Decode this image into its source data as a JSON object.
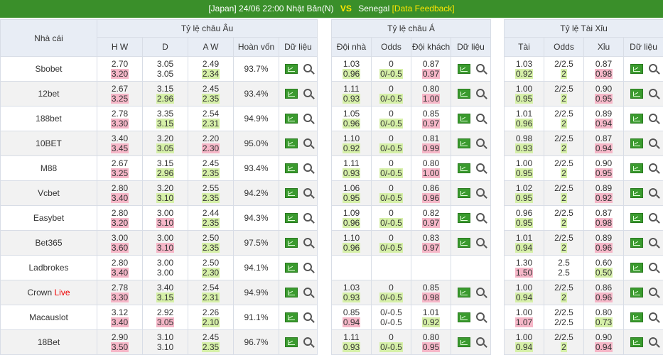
{
  "match": {
    "league": "[Japan]",
    "datetime": "24/06 22:00",
    "home": "Nhật Bản(N)",
    "vs": "VS",
    "away": "Senegal",
    "feedback": "[Data Feedback]"
  },
  "headers": {
    "bookmaker": "Nhà cái",
    "euro": "Tỷ lệ châu Âu",
    "asia": "Tỷ lệ châu Á",
    "ou": "Tỷ lệ Tài Xỉu",
    "euro_cols": [
      "H W",
      "D",
      "A W",
      "Hoàn vốn",
      "Dữ liệu"
    ],
    "asia_cols": [
      "Đội nhà",
      "Odds",
      "Đội khách",
      "Dữ liệu"
    ],
    "ou_cols": [
      "Tài",
      "Odds",
      "Xỉu",
      "Dữ liệu"
    ]
  },
  "rows": [
    {
      "book": "Sbobet",
      "live": "",
      "euro": [
        [
          "2.70",
          "3.20"
        ],
        [
          "3.05",
          "3.05"
        ],
        [
          "2.49",
          "2.34"
        ]
      ],
      "euro_hl": [
        "",
        "pk",
        "",
        "",
        "",
        "gr"
      ],
      "refund": "93.7%",
      "asia": [
        [
          "1.03",
          "0.96"
        ],
        [
          "0",
          "0/-0.5"
        ],
        [
          "0.87",
          "0.97"
        ]
      ],
      "asia_hl": [
        "",
        "gr",
        "",
        "gr",
        "",
        "pk"
      ],
      "ou": [
        [
          "1.03",
          "0.92"
        ],
        [
          "2/2.5",
          "2"
        ],
        [
          "0.87",
          "0.98"
        ]
      ],
      "ou_hl": [
        "",
        "gr",
        "",
        "gr",
        "",
        "pk"
      ]
    },
    {
      "book": "12bet",
      "live": "",
      "euro": [
        [
          "2.67",
          "3.25"
        ],
        [
          "3.15",
          "2.96"
        ],
        [
          "2.45",
          "2.35"
        ]
      ],
      "euro_hl": [
        "",
        "pk",
        "",
        "gr",
        "",
        "gr"
      ],
      "refund": "93.4%",
      "asia": [
        [
          "1.11",
          "0.93"
        ],
        [
          "0",
          "0/-0.5"
        ],
        [
          "0.80",
          "1.00"
        ]
      ],
      "asia_hl": [
        "",
        "gr",
        "",
        "gr",
        "",
        "pk"
      ],
      "ou": [
        [
          "1.00",
          "0.95"
        ],
        [
          "2/2.5",
          "2"
        ],
        [
          "0.90",
          "0.95"
        ]
      ],
      "ou_hl": [
        "",
        "gr",
        "",
        "gr",
        "",
        "pk"
      ]
    },
    {
      "book": "188bet",
      "live": "",
      "euro": [
        [
          "2.78",
          "3.30"
        ],
        [
          "3.35",
          "3.15"
        ],
        [
          "2.54",
          "2.31"
        ]
      ],
      "euro_hl": [
        "",
        "pk",
        "",
        "gr",
        "",
        "gr"
      ],
      "refund": "94.9%",
      "asia": [
        [
          "1.05",
          "0.96"
        ],
        [
          "0",
          "0/-0.5"
        ],
        [
          "0.85",
          "0.97"
        ]
      ],
      "asia_hl": [
        "",
        "gr",
        "",
        "gr",
        "",
        "pk"
      ],
      "ou": [
        [
          "1.01",
          "0.96"
        ],
        [
          "2/2.5",
          "2"
        ],
        [
          "0.89",
          "0.94"
        ]
      ],
      "ou_hl": [
        "",
        "gr",
        "",
        "gr",
        "",
        "pk"
      ]
    },
    {
      "book": "10BET",
      "live": "",
      "euro": [
        [
          "3.40",
          "3.45"
        ],
        [
          "3.20",
          "3.05"
        ],
        [
          "2.20",
          "2.30"
        ]
      ],
      "euro_hl": [
        "",
        "pk",
        "",
        "gr",
        "",
        "pk"
      ],
      "refund": "95.0%",
      "asia": [
        [
          "1.10",
          "0.92"
        ],
        [
          "0",
          "0/-0.5"
        ],
        [
          "0.81",
          "0.99"
        ]
      ],
      "asia_hl": [
        "",
        "gr",
        "",
        "gr",
        "",
        "pk"
      ],
      "ou": [
        [
          "0.98",
          "0.93"
        ],
        [
          "2/2.5",
          "2"
        ],
        [
          "0.87",
          "0.94"
        ]
      ],
      "ou_hl": [
        "",
        "gr",
        "",
        "gr",
        "",
        "pk"
      ]
    },
    {
      "book": "M88",
      "live": "",
      "euro": [
        [
          "2.67",
          "3.25"
        ],
        [
          "3.15",
          "2.96"
        ],
        [
          "2.45",
          "2.35"
        ]
      ],
      "euro_hl": [
        "",
        "pk",
        "",
        "gr",
        "",
        "gr"
      ],
      "refund": "93.4%",
      "asia": [
        [
          "1.11",
          "0.93"
        ],
        [
          "0",
          "0/-0.5"
        ],
        [
          "0.80",
          "1.00"
        ]
      ],
      "asia_hl": [
        "",
        "gr",
        "",
        "gr",
        "",
        "pk"
      ],
      "ou": [
        [
          "1.00",
          "0.95"
        ],
        [
          "2/2.5",
          "2"
        ],
        [
          "0.90",
          "0.95"
        ]
      ],
      "ou_hl": [
        "",
        "gr",
        "",
        "gr",
        "",
        "pk"
      ]
    },
    {
      "book": "Vcbet",
      "live": "",
      "euro": [
        [
          "2.80",
          "3.40"
        ],
        [
          "3.20",
          "3.10"
        ],
        [
          "2.55",
          "2.35"
        ]
      ],
      "euro_hl": [
        "",
        "pk",
        "",
        "gr",
        "",
        "gr"
      ],
      "refund": "94.2%",
      "asia": [
        [
          "1.06",
          "0.95"
        ],
        [
          "0",
          "0/-0.5"
        ],
        [
          "0.86",
          "0.96"
        ]
      ],
      "asia_hl": [
        "",
        "gr",
        "",
        "gr",
        "",
        "pk"
      ],
      "ou": [
        [
          "1.02",
          "0.95"
        ],
        [
          "2/2.5",
          "2"
        ],
        [
          "0.89",
          "0.92"
        ]
      ],
      "ou_hl": [
        "",
        "gr",
        "",
        "gr",
        "",
        "pk"
      ]
    },
    {
      "book": "Easybet",
      "live": "",
      "euro": [
        [
          "2.80",
          "3.20"
        ],
        [
          "3.00",
          "3.10"
        ],
        [
          "2.44",
          "2.35"
        ]
      ],
      "euro_hl": [
        "",
        "pk",
        "",
        "pk",
        "",
        "gr"
      ],
      "refund": "94.3%",
      "asia": [
        [
          "1.09",
          "0.96"
        ],
        [
          "0",
          "0/-0.5"
        ],
        [
          "0.82",
          "0.97"
        ]
      ],
      "asia_hl": [
        "",
        "gr",
        "",
        "gr",
        "",
        "pk"
      ],
      "ou": [
        [
          "0.96",
          "0.95"
        ],
        [
          "2/2.5",
          "2"
        ],
        [
          "0.87",
          "0.98"
        ]
      ],
      "ou_hl": [
        "",
        "gr",
        "",
        "gr",
        "",
        "pk"
      ]
    },
    {
      "book": "Bet365",
      "live": "",
      "euro": [
        [
          "3.00",
          "3.60"
        ],
        [
          "3.00",
          "3.10"
        ],
        [
          "2.50",
          "2.35"
        ]
      ],
      "euro_hl": [
        "",
        "pk",
        "",
        "pk",
        "",
        "gr"
      ],
      "refund": "97.5%",
      "asia": [
        [
          "1.10",
          "0.96"
        ],
        [
          "0",
          "0/-0.5"
        ],
        [
          "0.83",
          "0.97"
        ]
      ],
      "asia_hl": [
        "",
        "gr",
        "",
        "gr",
        "",
        "pk"
      ],
      "ou": [
        [
          "1.01",
          "0.94"
        ],
        [
          "2/2.5",
          "2"
        ],
        [
          "0.89",
          "0.96"
        ]
      ],
      "ou_hl": [
        "",
        "gr",
        "",
        "gr",
        "",
        "pk"
      ]
    },
    {
      "book": "Ladbrokes",
      "live": "",
      "euro": [
        [
          "2.80",
          "3.40"
        ],
        [
          "3.00",
          "3.00"
        ],
        [
          "2.50",
          "2.30"
        ]
      ],
      "euro_hl": [
        "",
        "pk",
        "",
        "",
        "",
        "gr"
      ],
      "refund": "94.1%",
      "asia": [
        [
          "",
          ""
        ],
        [
          "",
          ""
        ],
        [
          "",
          ""
        ]
      ],
      "asia_hl": [
        "",
        "",
        "",
        "",
        "",
        ""
      ],
      "ou": [
        [
          "1.30",
          "1.50"
        ],
        [
          "2.5",
          "2.5"
        ],
        [
          "0.60",
          "0.50"
        ]
      ],
      "ou_hl": [
        "",
        "pk",
        "",
        "",
        "",
        "gr"
      ]
    },
    {
      "book": "Crown",
      "live": "Live",
      "euro": [
        [
          "2.78",
          "3.30"
        ],
        [
          "3.40",
          "3.15"
        ],
        [
          "2.54",
          "2.31"
        ]
      ],
      "euro_hl": [
        "",
        "pk",
        "",
        "gr",
        "",
        "gr"
      ],
      "refund": "94.9%",
      "asia": [
        [
          "1.03",
          "0.93"
        ],
        [
          "0",
          "0/-0.5"
        ],
        [
          "0.85",
          "0.98"
        ]
      ],
      "asia_hl": [
        "",
        "gr",
        "",
        "gr",
        "",
        "pk"
      ],
      "ou": [
        [
          "1.00",
          "0.94"
        ],
        [
          "2/2.5",
          "2"
        ],
        [
          "0.86",
          "0.96"
        ]
      ],
      "ou_hl": [
        "",
        "gr",
        "",
        "gr",
        "",
        "pk"
      ]
    },
    {
      "book": "Macauslot",
      "live": "",
      "euro": [
        [
          "3.12",
          "3.40"
        ],
        [
          "2.92",
          "3.05"
        ],
        [
          "2.26",
          "2.10"
        ]
      ],
      "euro_hl": [
        "",
        "pk",
        "",
        "pk",
        "",
        "gr"
      ],
      "refund": "91.1%",
      "asia": [
        [
          "0.85",
          "0.94"
        ],
        [
          "0/-0.5",
          "0/-0.5"
        ],
        [
          "1.01",
          "0.92"
        ]
      ],
      "asia_hl": [
        "",
        "pk",
        "",
        "",
        "",
        "gr"
      ],
      "ou": [
        [
          "1.00",
          "1.07"
        ],
        [
          "2/2.5",
          "2/2.5"
        ],
        [
          "0.80",
          "0.73"
        ]
      ],
      "ou_hl": [
        "",
        "pk",
        "",
        "",
        "",
        "gr"
      ]
    },
    {
      "book": "18Bet",
      "live": "",
      "euro": [
        [
          "2.90",
          "3.50"
        ],
        [
          "3.10",
          "3.10"
        ],
        [
          "2.45",
          "2.35"
        ]
      ],
      "euro_hl": [
        "",
        "pk",
        "",
        "",
        "",
        "gr"
      ],
      "refund": "96.7%",
      "asia": [
        [
          "1.11",
          "0.93"
        ],
        [
          "0",
          "0/-0.5"
        ],
        [
          "0.80",
          "0.95"
        ]
      ],
      "asia_hl": [
        "",
        "gr",
        "",
        "gr",
        "",
        "pk"
      ],
      "ou": [
        [
          "1.00",
          "0.94"
        ],
        [
          "2/2.5",
          "2"
        ],
        [
          "0.90",
          "0.94"
        ]
      ],
      "ou_hl": [
        "",
        "gr",
        "",
        "gr",
        "",
        "pk"
      ]
    }
  ],
  "colors": {
    "header_bar": "#3a8f2a",
    "accent": "#ffe600",
    "pink": "#f6b7c8",
    "green": "#d6f0a8",
    "live": "#e00000"
  },
  "icons": {
    "chart": "chart-icon",
    "search": "search-icon"
  }
}
